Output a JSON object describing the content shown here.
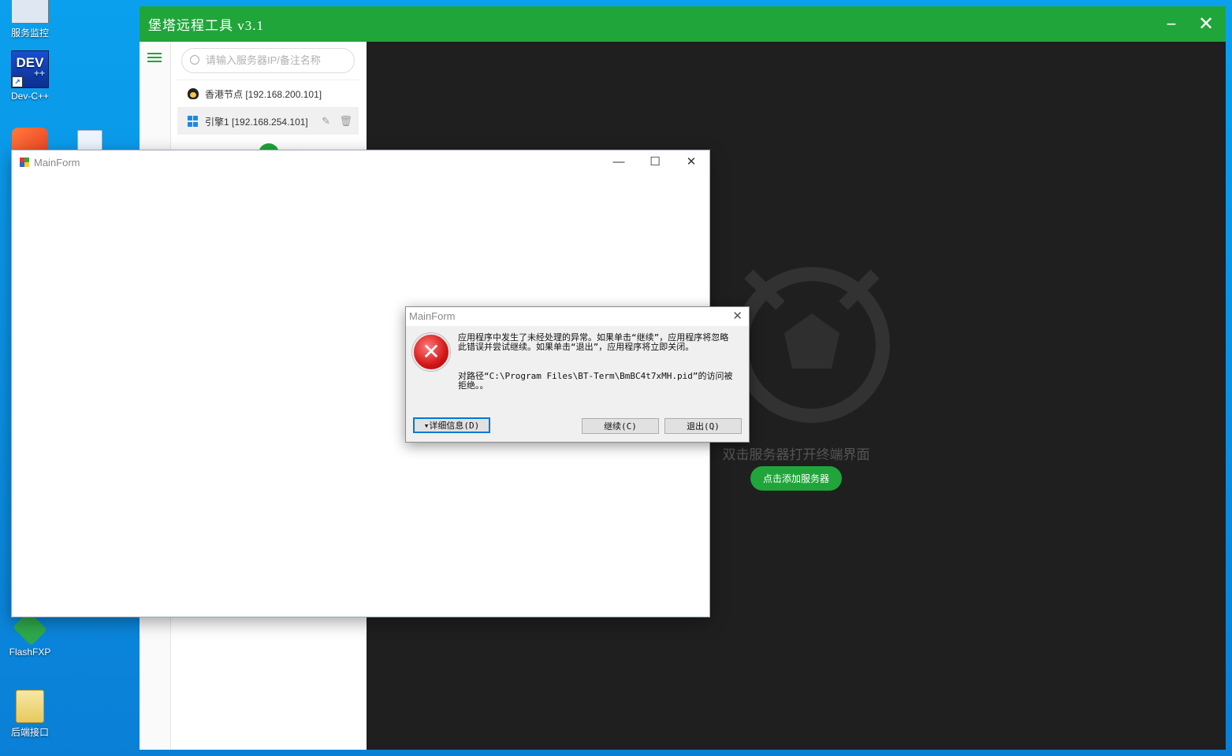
{
  "desktop": {
    "icons": [
      {
        "label": "服务监控"
      },
      {
        "label": "Dev-C++",
        "badge": "DEV"
      },
      {
        "label": "FlashFXP"
      },
      {
        "label": "后端接口"
      }
    ]
  },
  "bt_app": {
    "title": "堡塔远程工具 v3.1",
    "search_placeholder": "请输入服务器IP/备注名称",
    "servers": [
      {
        "name": "香港节点 [192.168.200.101]",
        "os": "linux"
      },
      {
        "name": "引擎1 [192.168.254.101]",
        "os": "windows"
      }
    ],
    "empty_hint": "双击服务器打开终端界面",
    "add_server_label": "点击添加服务器",
    "accent_color": "#20a53a"
  },
  "mainform": {
    "title": "MainForm"
  },
  "error_dialog": {
    "title": "MainForm",
    "message": "应用程序中发生了未经处理的异常。如果单击“继续”，应用程序将忽略此错误并尝试继续。如果单击“退出”，应用程序将立即关闭。",
    "detail": "对路径“C:\\Program Files\\BT-Term\\BmBC4t7xMH.pid”的访问被拒绝。。",
    "details_button": "▾详细信息(D)",
    "continue_button": "继续(C)",
    "quit_button": "退出(Q)"
  }
}
